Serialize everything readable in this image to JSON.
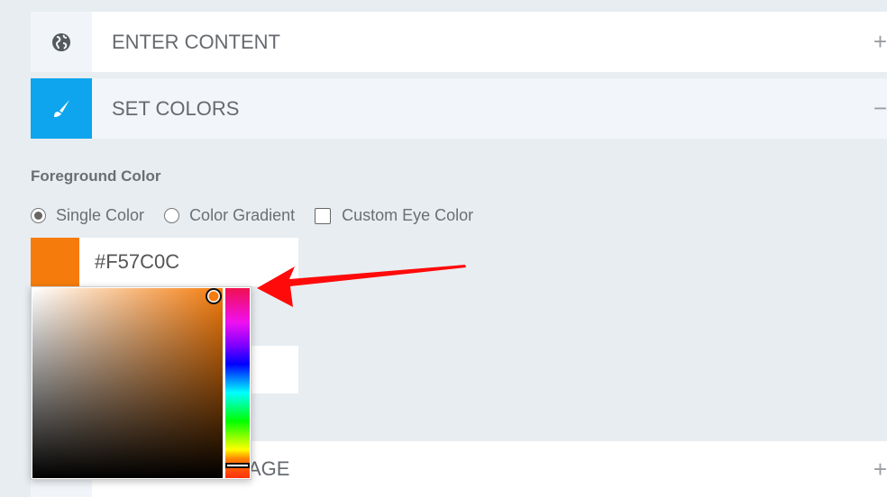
{
  "sections": [
    {
      "title": "ENTER CONTENT",
      "icon": "globe-icon",
      "toggle": "+"
    },
    {
      "title": "SET COLORS",
      "icon": "paintbrush-icon",
      "toggle": "−"
    },
    {
      "title_visible": "AGE",
      "icon": "image-icon",
      "toggle": "+"
    }
  ],
  "foreground": {
    "label": "Foreground Color",
    "options": [
      "Single Color",
      "Color Gradient",
      "Custom Eye Color"
    ],
    "selected": "Single Color",
    "custom_eye_checked": false,
    "hex": "#F57C0C"
  },
  "colors": {
    "accent": "#0ea5ee",
    "swatch": "#F57C0C",
    "arrow": "#ff0000"
  }
}
